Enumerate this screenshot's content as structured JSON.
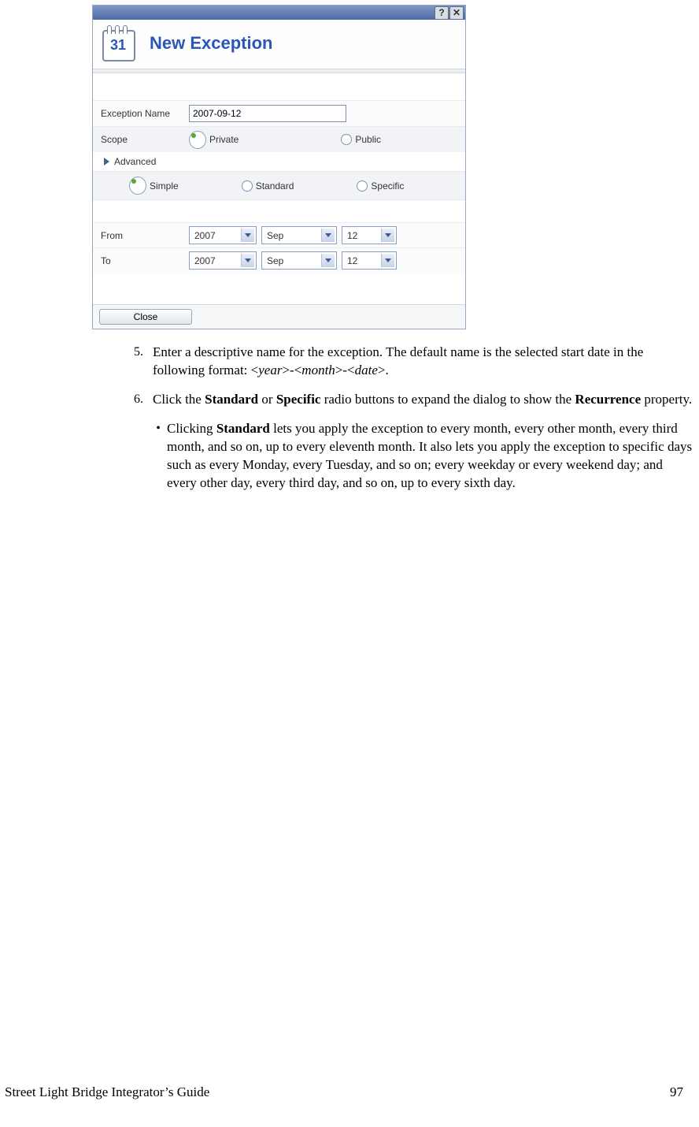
{
  "dialog": {
    "title": "New Exception",
    "cal_icon_day": "31",
    "titlebar": {
      "help": "?",
      "close": "✕"
    },
    "exception_name_label": "Exception Name",
    "exception_name_value": "2007-09-12",
    "scope_label": "Scope",
    "scope_options": {
      "private": "Private",
      "public": "Public"
    },
    "advanced_label": "Advanced",
    "mode_options": {
      "simple": "Simple",
      "standard": "Standard",
      "specific": "Specific"
    },
    "from_label": "From",
    "to_label": "To",
    "from": {
      "year": "2007",
      "month": "Sep",
      "day": "12"
    },
    "to": {
      "year": "2007",
      "month": "Sep",
      "day": "12"
    },
    "close_button": "Close"
  },
  "doc": {
    "step5_num": "5.",
    "step5_a": "Enter a descriptive name for the exception.  The default name is the selected start date in the following format: <",
    "step5_year": "year",
    "step5_b": ">-<",
    "step5_month": "month",
    "step5_c": ">-<",
    "step5_date": "date",
    "step5_d": ">.",
    "step6_num": "6.",
    "step6_a": "Click the ",
    "step6_standard": "Standard",
    "step6_b": " or ",
    "step6_specific": "Specific",
    "step6_c": " radio buttons to expand the dialog to show the ",
    "step6_recurrence": "Recurrence",
    "step6_d": " property.",
    "bullet": "•",
    "bul_a": "Clicking ",
    "bul_standard": "Standard",
    "bul_b": " lets you apply the exception to every month, every other month, every third month, and so on, up to every eleventh month.  It also lets you apply the exception to specific days such as every Monday, every Tuesday, and so on; every weekday or every weekend day; and every other day, every third day, and so on, up to every sixth day."
  },
  "footer": {
    "title": "Street Light Bridge Integrator’s Guide",
    "page": "97"
  }
}
